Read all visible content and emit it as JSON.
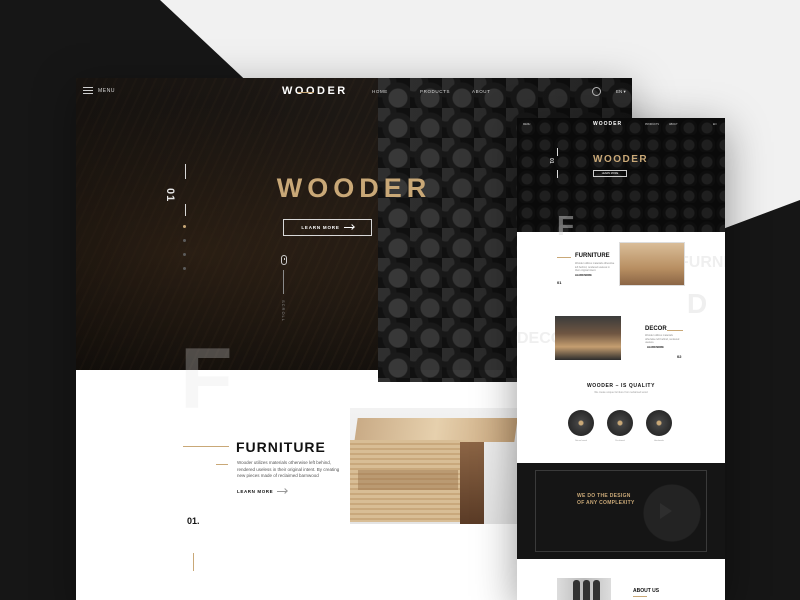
{
  "colors": {
    "accent_gold": "#c9a877",
    "dark": "#161616",
    "text_dark": "#111111"
  },
  "main": {
    "nav": {
      "menu_label": "MENU",
      "logo": "WOODER",
      "links": [
        "HOME",
        "PRODUCTS",
        "ABOUT"
      ],
      "search_icon": "search-icon",
      "lang": "EN ▾"
    },
    "hero": {
      "slide_number": "01",
      "title": "WOODER",
      "button_label": "LEARN MORE",
      "scroll_label": "SCROLL",
      "slide_count": 4,
      "active_slide": 1
    },
    "furniture": {
      "bg_letter": "F",
      "title": "FURNITURE",
      "description": "Wooder utilizes materials otherwise left behind, rendered useless in their original intent. By creating new pieces made of reclaimed barnwood",
      "learn_more": "LEARN MORE",
      "number": "01."
    }
  },
  "side": {
    "nav": {
      "menu": "MENU",
      "logo": "WOODER",
      "products": "PRODUCTS",
      "about": "ABOUT",
      "lang": "EN"
    },
    "hero": {
      "num": "01",
      "title": "WOODER",
      "button": "LEARN MORE"
    },
    "sections": {
      "furniture_title": "FURNITURE",
      "furniture_text": "Wooder utilizes materials otherwise left behind, rendered useless in their original intent.",
      "furniture_learn": "LEARN MORE",
      "num1": "01",
      "decor_title": "DECOR",
      "decor_text": "Wooder utilizes materials otherwise left behind, rendered useless.",
      "decor_learn": "LEARN MORE",
      "num2": "02",
      "bg_f": "F",
      "bg_furnitu": "FURNITU",
      "bg_d": "D",
      "bg_decor": "DECOR"
    },
    "quality": {
      "title": "WOODER – IS QUALITY",
      "subtitle": "We create unique furniture from reclaimed wood",
      "items": [
        "Natural wood",
        "Reclaimed",
        "Handmade"
      ]
    },
    "design": {
      "line1": "WE DO THE DESIGN",
      "line2": "OF ANY COMPLEXITY",
      "play_icon": "play-icon"
    },
    "about": {
      "title": "ABOUT US"
    }
  }
}
